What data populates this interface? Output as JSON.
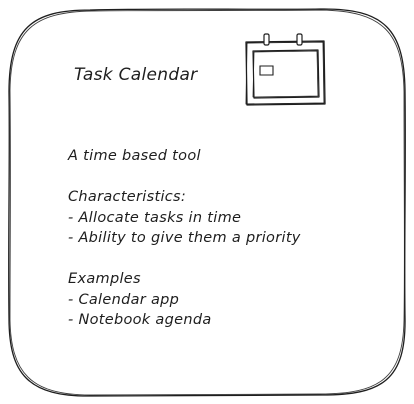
{
  "card": {
    "title": "Task Calendar",
    "icon": "calendar-icon",
    "description": "A time based tool",
    "characteristics": {
      "heading": "Characteristics:",
      "items": [
        "- Allocate tasks in time",
        "- Ability to give them a priority"
      ]
    },
    "examples": {
      "heading": "Examples",
      "items": [
        "- Calendar app",
        "- Notebook agenda"
      ]
    }
  },
  "colors": {
    "stroke": "#1e1e1e",
    "background": "#ffffff"
  }
}
